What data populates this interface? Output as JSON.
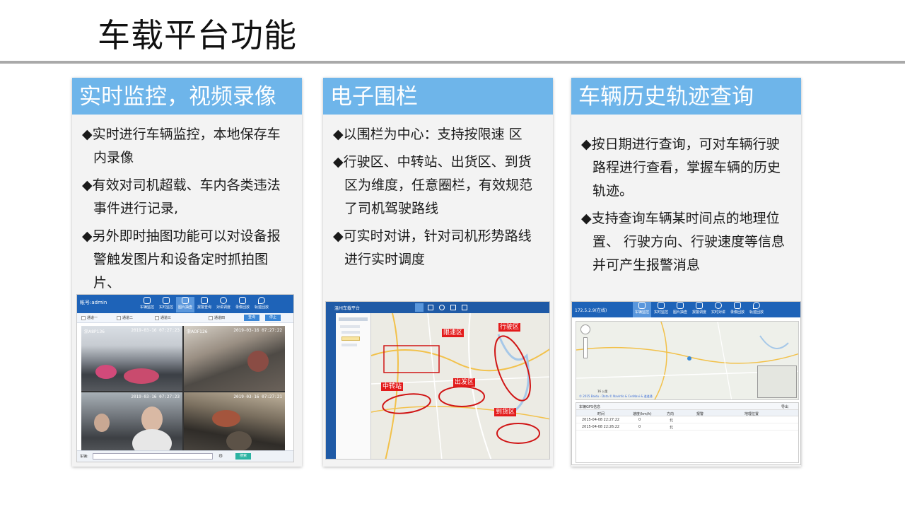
{
  "slide_title": "车载平台功能",
  "cards": [
    {
      "header": "实时监控，视频录像",
      "bullets": [
        "◆实时进行车辆监控，本地保存车内录像",
        "◆有效对司机超载、车内各类违法事件进行记录,",
        "◆另外即时抽图功能可以对设备报警触发图片和设备定时抓拍图片、"
      ]
    },
    {
      "header": "电子围栏",
      "bullets": [
        "◆以围栏为中心：支持按限速 区",
        "◆行驶区、中转站、出货区、到货区为维度，任意圈栏，有效规范了司机驾驶路线",
        "◆可实时对讲，针对司机形势路线进行实时调度"
      ]
    },
    {
      "header": "车辆历史轨迹查询",
      "bullets": [
        "◆按日期进行查询，可对车辆行驶路程进行查看，掌握车辆的历史轨迹。",
        "◆支持查询车辆某时间点的地理位置、 行驶方向、行驶速度等信息并可产生报警消息"
      ]
    }
  ],
  "shot1": {
    "account": "帐号:admin",
    "toolbar": [
      "车辆监控",
      "实时监控",
      "图片抽查",
      "报警查询",
      "对讲调度",
      "录像回放",
      "轨迹回放"
    ],
    "channels": [
      "通道一",
      "通道二",
      "通道三",
      "通道四"
    ],
    "query_btn": "查询",
    "stop_btn": "停止",
    "plates": [
      "浙A8P136",
      "浙AOF126"
    ],
    "timestamps": [
      "2019-03-16 07:27:23",
      "2019-03-16 07:27:22",
      "2019-03-16 07:27:23",
      "2019-03-16 07:27:21"
    ],
    "footer_label": "车辆:",
    "footer_btn": "搜索"
  },
  "shot2": {
    "app_name": "温州车载平台",
    "zones": [
      "限速区",
      "行驶区",
      "中转站",
      "出发区",
      "到货区"
    ]
  },
  "shot3": {
    "ip": "172.5.2.9(在线)",
    "toolbar": [
      "车辆监控",
      "实时监控",
      "图片抽查",
      "报警调度",
      "实时对讲",
      "录像回放",
      "轨迹回放"
    ],
    "table_caption": "车辆GPS信息",
    "columns": [
      "时间",
      "速度(km/h)",
      "方向",
      "报警",
      "地理位置"
    ],
    "rows": [
      [
        "2015-04-08 22:27:22",
        "0",
        "北",
        "",
        ""
      ],
      [
        "2015-04-08 22:26:22",
        "0",
        "北",
        "",
        ""
      ]
    ],
    "map_scale": "16 公里",
    "map_credit": "© 2015 Baidu - Data © NavInfo & CenNavi & 道道通",
    "export_label": "导出"
  }
}
